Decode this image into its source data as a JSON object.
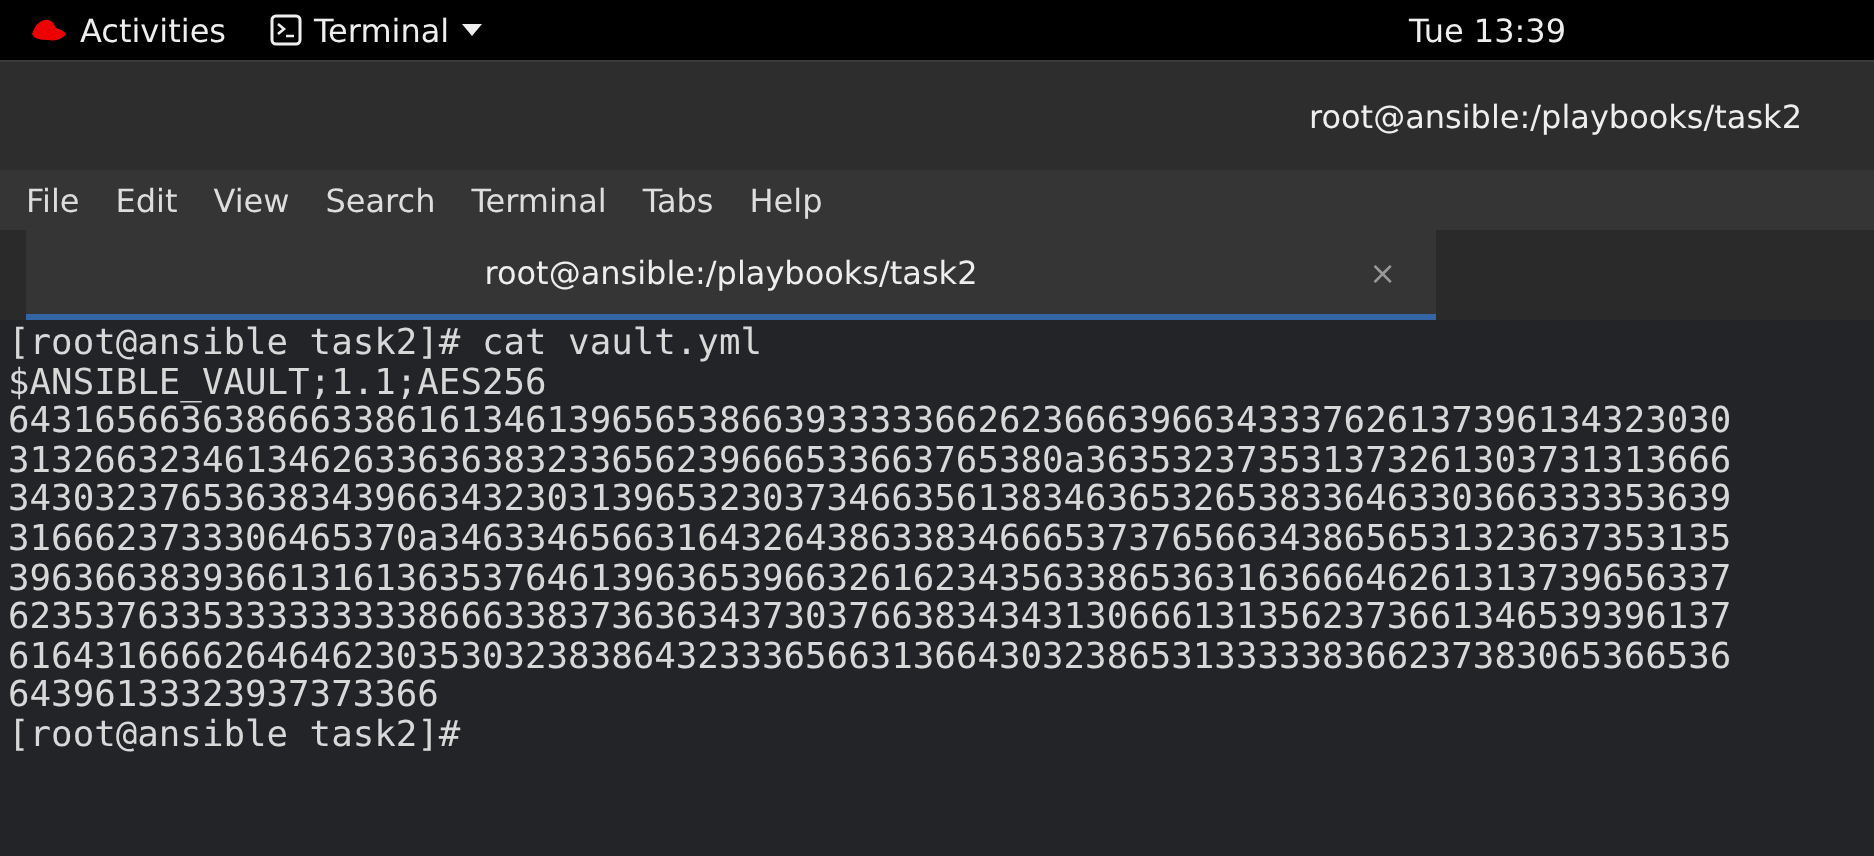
{
  "top_bar": {
    "activities": "Activities",
    "app_menu": "Terminal",
    "clock": "Tue 13:39"
  },
  "window": {
    "title": "root@ansible:/playbooks/task2"
  },
  "menu": [
    "File",
    "Edit",
    "View",
    "Search",
    "Terminal",
    "Tabs",
    "Help"
  ],
  "tabs": [
    {
      "label": "root@ansible:/playbooks/task2",
      "selected": true,
      "close": "×"
    }
  ],
  "terminal_lines": [
    "[root@ansible task2]# cat vault.yml",
    "$ANSIBLE_VAULT;1.1;AES256",
    "64316566363866633861613461396565386639333336626236663966343337626137396134323030",
    "3132663234613462633636383233656239666533663765380a363532373531373261303731313666",
    "34303237653638343966343230313965323037346635613834636532653833646330366333353639",
    "3166623733306465370a346334656631643264386338346665373765663438656531323637353135",
    "39636638393661316136353764613963653966326162343563386536316366646261313739656337",
    "62353763353333333338666338373636343730376638343431306661313562373661346539396137",
    "61643166662646462303530323838643233365663136643032386531333338366237383065366536",
    "64396133323937373366",
    "[root@ansible task2]#"
  ]
}
